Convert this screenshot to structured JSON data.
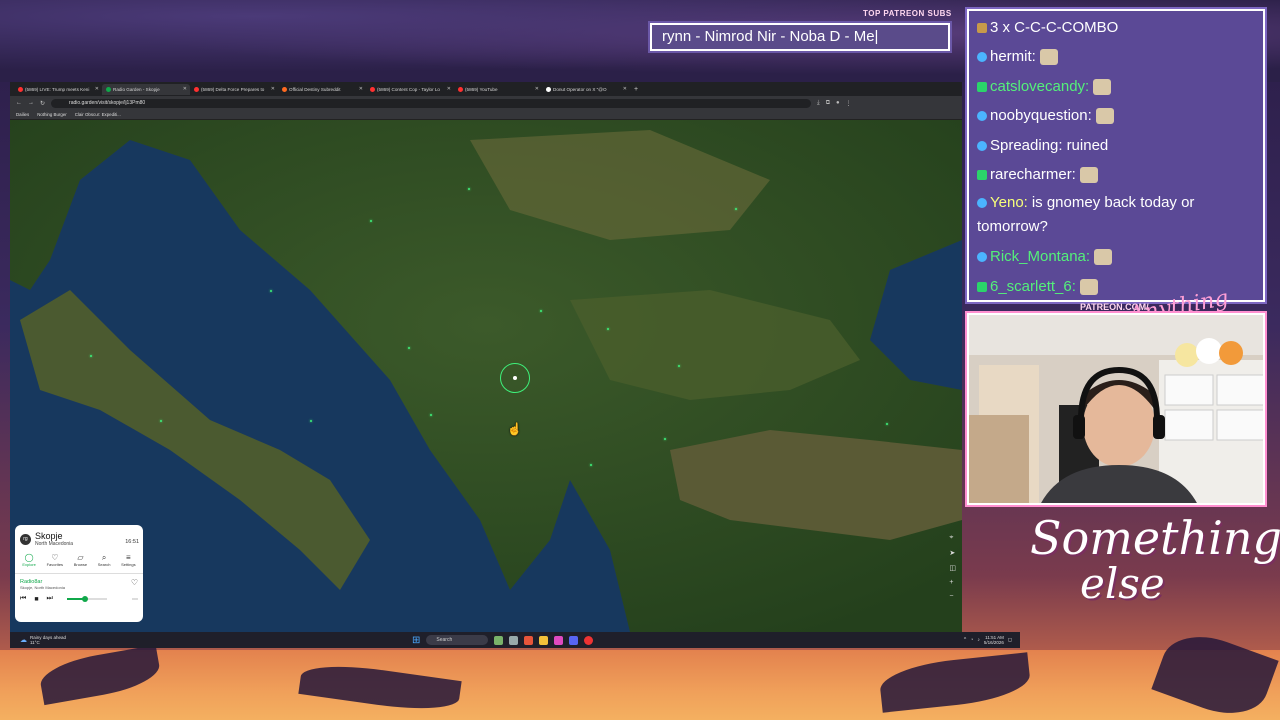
{
  "overlay": {
    "subs_label": "TOP PATREON SUBS",
    "subs_ticker": "rynn - Nimrod Nir - Noba D - Me|",
    "patreon_label": "PATREON.COM/",
    "logo_small": "Anything Else",
    "logo_big_line1": "Something",
    "logo_big_line2": "else"
  },
  "browser": {
    "tabs": [
      {
        "label": "(5869) LIVE: Trump meets Keni",
        "active": false,
        "favicon_color": "#ff3030"
      },
      {
        "label": "Radio Garden - Skopje",
        "active": true,
        "favicon_color": "#10a84a"
      },
      {
        "label": "(5869) Delta Force Prepares to",
        "active": false,
        "favicon_color": "#ff3030"
      },
      {
        "label": "Official Destiny Subreddit",
        "active": false,
        "favicon_color": "#ff6a20"
      },
      {
        "label": "(5869) Content Cop - Taylor Lo",
        "active": false,
        "favicon_color": "#ff3030"
      },
      {
        "label": "(5869) YouTube",
        "active": false,
        "favicon_color": "#ff3030"
      },
      {
        "label": "Donut Operator on X \"@O",
        "active": false,
        "favicon_color": "#ffffff"
      }
    ],
    "url": "radio.garden/visit/skopje/lj13Pm80",
    "bookmarks": [
      "Dailies",
      "Nothing Burger",
      "Clair Obscur: Expediti..."
    ]
  },
  "radio_panel": {
    "city": "Skopje",
    "country": "North Macedonia",
    "time": "16:51",
    "nav": [
      {
        "label": "Explore",
        "icon": "explore-icon",
        "glyph": "◯"
      },
      {
        "label": "Favorites",
        "icon": "heart-icon",
        "glyph": "♡"
      },
      {
        "label": "Browse",
        "icon": "map-icon",
        "glyph": "▱"
      },
      {
        "label": "Search",
        "icon": "search-icon",
        "glyph": "⌕"
      },
      {
        "label": "Settings",
        "icon": "menu-icon",
        "glyph": "≡"
      }
    ],
    "station": "Radio8ar",
    "station_location": "Skopje, North Macedonia",
    "volume": 0.45
  },
  "taskbar": {
    "weather_line1": "Rainy days ahead",
    "weather_line2": "11°C",
    "search_placeholder": "Search",
    "clock_time": "11:51 AM",
    "clock_date": "5/16/2026"
  },
  "chat": {
    "messages": [
      {
        "badge": "bitbadge",
        "user": "3 x C-C-C-COMBO",
        "text": "",
        "color": "#ffffff"
      },
      {
        "badge": "sub",
        "user": "hermit:",
        "text": "",
        "color": "#ffffff",
        "emote": true
      },
      {
        "badge": "k",
        "user": "catslovecandy:",
        "text": "",
        "color": "#54f07a",
        "emote": true
      },
      {
        "badge": "sub",
        "user": "noobyquestion:",
        "text": "",
        "color": "#ffffff",
        "emote": true
      },
      {
        "badge": "sub",
        "user": "Spreading:",
        "text": "ruined",
        "color": "#ffffff"
      },
      {
        "badge": "k",
        "user": "rarecharmer:",
        "text": "",
        "color": "#ffffff",
        "emote": true
      },
      {
        "badge": "sub",
        "user": "Yeno:",
        "text": "is gnomey back today or tomorrow?",
        "color": "#f7ff7a",
        "wrap": true
      },
      {
        "badge": "sub",
        "user": "Rick_Montana:",
        "text": "",
        "color": "#54f07a",
        "emote": true
      },
      {
        "badge": "k",
        "user": "6_scarlett_6:",
        "text": "",
        "color": "#54f07a",
        "emote": true
      }
    ]
  }
}
